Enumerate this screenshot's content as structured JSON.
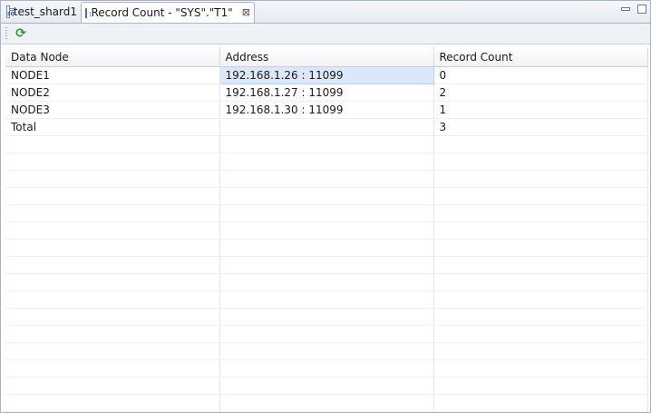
{
  "tabs": [
    {
      "label": "test_shard1",
      "icon": "sql-file-icon"
    },
    {
      "label": "Record Count - \"SYS\".\"T1\"",
      "icon": "table-icon",
      "close": "⊠"
    }
  ],
  "window_controls": [
    "minimize-icon",
    "maximize-icon"
  ],
  "toolbar": {
    "refresh_icon": "refresh-icon"
  },
  "table": {
    "columns": [
      "Data Node",
      "Address",
      "Record Count"
    ],
    "rows": [
      [
        "NODE1",
        "192.168.1.26 : 11099",
        "0"
      ],
      [
        "NODE2",
        "192.168.1.27 : 11099",
        "2"
      ],
      [
        "NODE3",
        "192.168.1.30 : 11099",
        "1"
      ],
      [
        "Total",
        "",
        "3"
      ]
    ],
    "selected_cell": "192.168.1.26 : 11099"
  }
}
